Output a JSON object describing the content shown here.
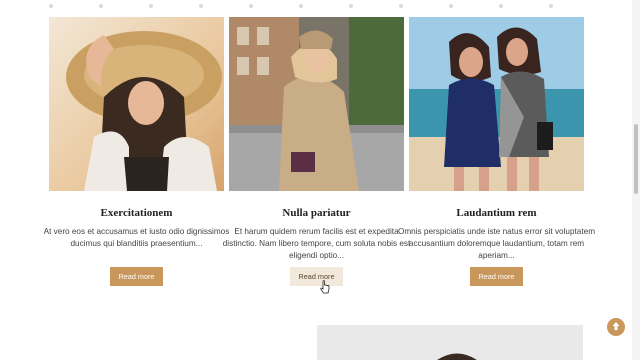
{
  "cards": [
    {
      "photo_icon": "woman-straw-hat-photo",
      "title": "Exercitationem",
      "description": "At vero eos et accusamus et iusto odio dignissimos ducimus qui blanditiis praesentium...",
      "button_label": "Read more"
    },
    {
      "photo_icon": "woman-beige-trench-coat-photo",
      "title": "Nulla pariatur",
      "description": "Et harum quidem rerum facilis est et expedita distinctio. Nam libero tempore, cum soluta nobis est eligendi optio...",
      "button_label": "Read more"
    },
    {
      "photo_icon": "two-women-beach-photo",
      "title": "Laudantium rem",
      "description": "Omnis perspiciatis unde iste natus error sit voluptatem accusantium doloremque laudantium, totam rem aperiam...",
      "button_label": "Read more"
    }
  ],
  "colors": {
    "accent": "#c9975b",
    "button_hover_bg": "#f2e9dc",
    "title_text": "#222222",
    "body_text": "#444444"
  },
  "back_to_top": {
    "icon": "arrow-up-circle-icon"
  }
}
